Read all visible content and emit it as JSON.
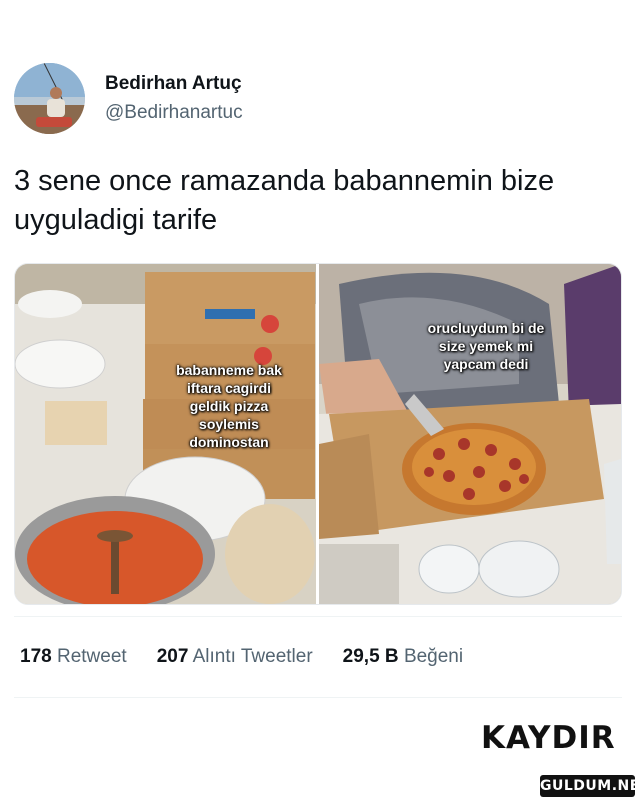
{
  "tweet": {
    "display_name": "Bedirhan Artuç",
    "handle": "@Bedirhanartuc",
    "text": "3 sene once ramazanda babannemin bize uyguladigi tarife"
  },
  "media": {
    "left_caption": "babanneme bak\niftara cagirdi\ngeldik pizza\nsoylemis\ndominostan",
    "right_caption": "orucluydum bi de\nsize yemek mi\nyapcam dedi"
  },
  "stats": {
    "retweet_count": "178",
    "retweet_label": "Retweet",
    "quote_count": "207",
    "quote_label": "Alıntı Tweetler",
    "like_count": "29,5 B",
    "like_label": "Beğeni"
  },
  "overlay": {
    "scroll_label": "KAYDIR",
    "watermark": "GULDUM.NET"
  }
}
